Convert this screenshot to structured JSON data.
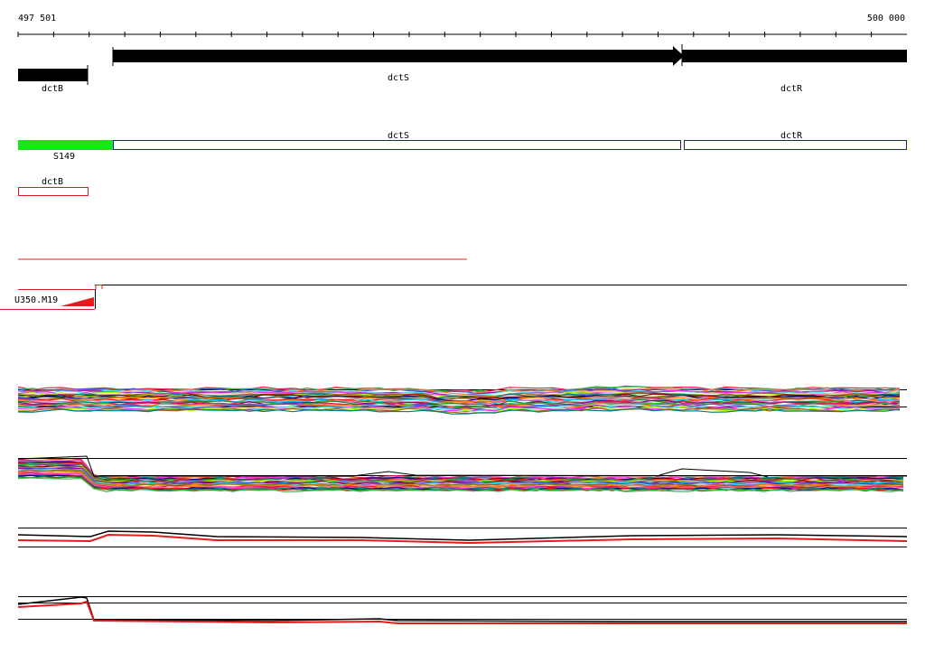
{
  "ruler": {
    "start_label": "497 501",
    "end_label": "500 000"
  },
  "genes": [
    {
      "name": "dctB"
    },
    {
      "name": "dctS"
    },
    {
      "name": "dctR"
    }
  ],
  "annotation_track": {
    "segment_label": "S149",
    "features": [
      {
        "name": "dctS"
      },
      {
        "name": "dctR"
      }
    ]
  },
  "lower_feature": {
    "name": "dctB"
  },
  "marker": {
    "label": "U350.M19"
  },
  "colors": {
    "gene": "#000000",
    "annotation_outline": "#1a1ab4",
    "segment_fill": "#19e619",
    "lower_feature_outline": "#d42020",
    "red_line": "#e61c1c",
    "trace_palette": [
      "#e6194b",
      "#3cb44b",
      "#4363d8",
      "#f58231",
      "#911eb4",
      "#46f0f0",
      "#f032e6",
      "#bcf60c",
      "#9a6324",
      "#008080",
      "#800000",
      "#808000",
      "#000075",
      "#808080",
      "#ff7f00",
      "#e41a1c",
      "#00bfff",
      "#ff69b4",
      "#228b22",
      "#8b008b"
    ]
  }
}
